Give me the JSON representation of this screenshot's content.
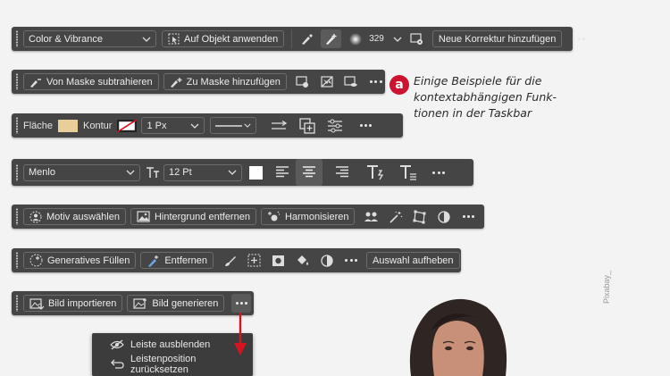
{
  "bar1": {
    "dropdown": "Color & Vibrance",
    "apply_label": "Auf Objekt anwenden",
    "brush_size": "329",
    "new_correction_label": "Neue Korrektur hinzufügen"
  },
  "bar2": {
    "subtract_label": "Von Maske subtrahieren",
    "add_label": "Zu Maske hinzufügen"
  },
  "bar3": {
    "fill_label": "Fläche",
    "stroke_label": "Kontur",
    "stroke_width": "1 Px",
    "fill_color": "#e8cf9a"
  },
  "bar4": {
    "font": "Menlo",
    "size": "12 Pt"
  },
  "bar5": {
    "select_subject": "Motiv auswählen",
    "remove_bg": "Hintergrund entfernen",
    "harmonize": "Harmonisieren"
  },
  "bar6": {
    "generative_fill": "Generatives Füllen",
    "remove": "Entfernen",
    "deselect": "Auswahl aufheben"
  },
  "bar7": {
    "import_image": "Bild importieren",
    "generate_image": "Bild generieren"
  },
  "menu": {
    "hide_bar": "Leiste ausblenden",
    "reset_position": "Leistenposition zurücksetzen"
  },
  "annotation": {
    "badge": "a",
    "lines": [
      "Einige Beispiele für die",
      "kontextabhängigen Funk-",
      "tionen in der Taskbar"
    ]
  },
  "credit": "Pixabay_",
  "colors": {
    "bar_bg": "#454545",
    "badge": "#cc1430",
    "arrow": "#d4141e"
  }
}
